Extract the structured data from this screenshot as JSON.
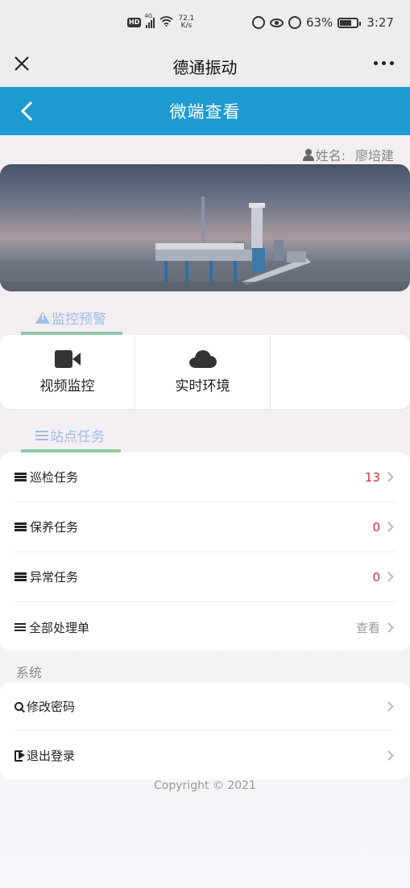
{
  "status_bar": {
    "hd": "HD",
    "network": "4G",
    "speed_value": "72.1",
    "speed_unit": "K/s",
    "battery": "63%",
    "time": "3:27"
  },
  "wechat_header": {
    "title": "德通振动"
  },
  "app_header": {
    "title": "微端查看"
  },
  "user": {
    "label": "姓名:",
    "name": "廖培建"
  },
  "sections": {
    "monitor": {
      "title": "监控预警",
      "items": [
        {
          "label": "视频监控",
          "icon": "video-camera-icon"
        },
        {
          "label": "实时环境",
          "icon": "cloud-icon"
        }
      ]
    },
    "tasks": {
      "title": "站点任务",
      "items": [
        {
          "label": "巡检任务",
          "value": "13",
          "icon": "server-icon"
        },
        {
          "label": "保养任务",
          "value": "0",
          "icon": "server-icon"
        },
        {
          "label": "异常任务",
          "value": "0",
          "icon": "server-icon"
        },
        {
          "label": "全部处理单",
          "value": "查看",
          "icon": "list-icon"
        }
      ]
    },
    "system": {
      "title": "系统",
      "items": [
        {
          "label": "修改密码",
          "icon": "key-icon"
        },
        {
          "label": "退出登录",
          "icon": "logout-icon"
        }
      ]
    }
  },
  "footer": {
    "copyright": "Copyright © 2021"
  },
  "colors": {
    "accent": "#1d9bd1",
    "section_bar": "#8fc9a5",
    "section_title": "#9fbde6",
    "count": "#d0303a"
  }
}
